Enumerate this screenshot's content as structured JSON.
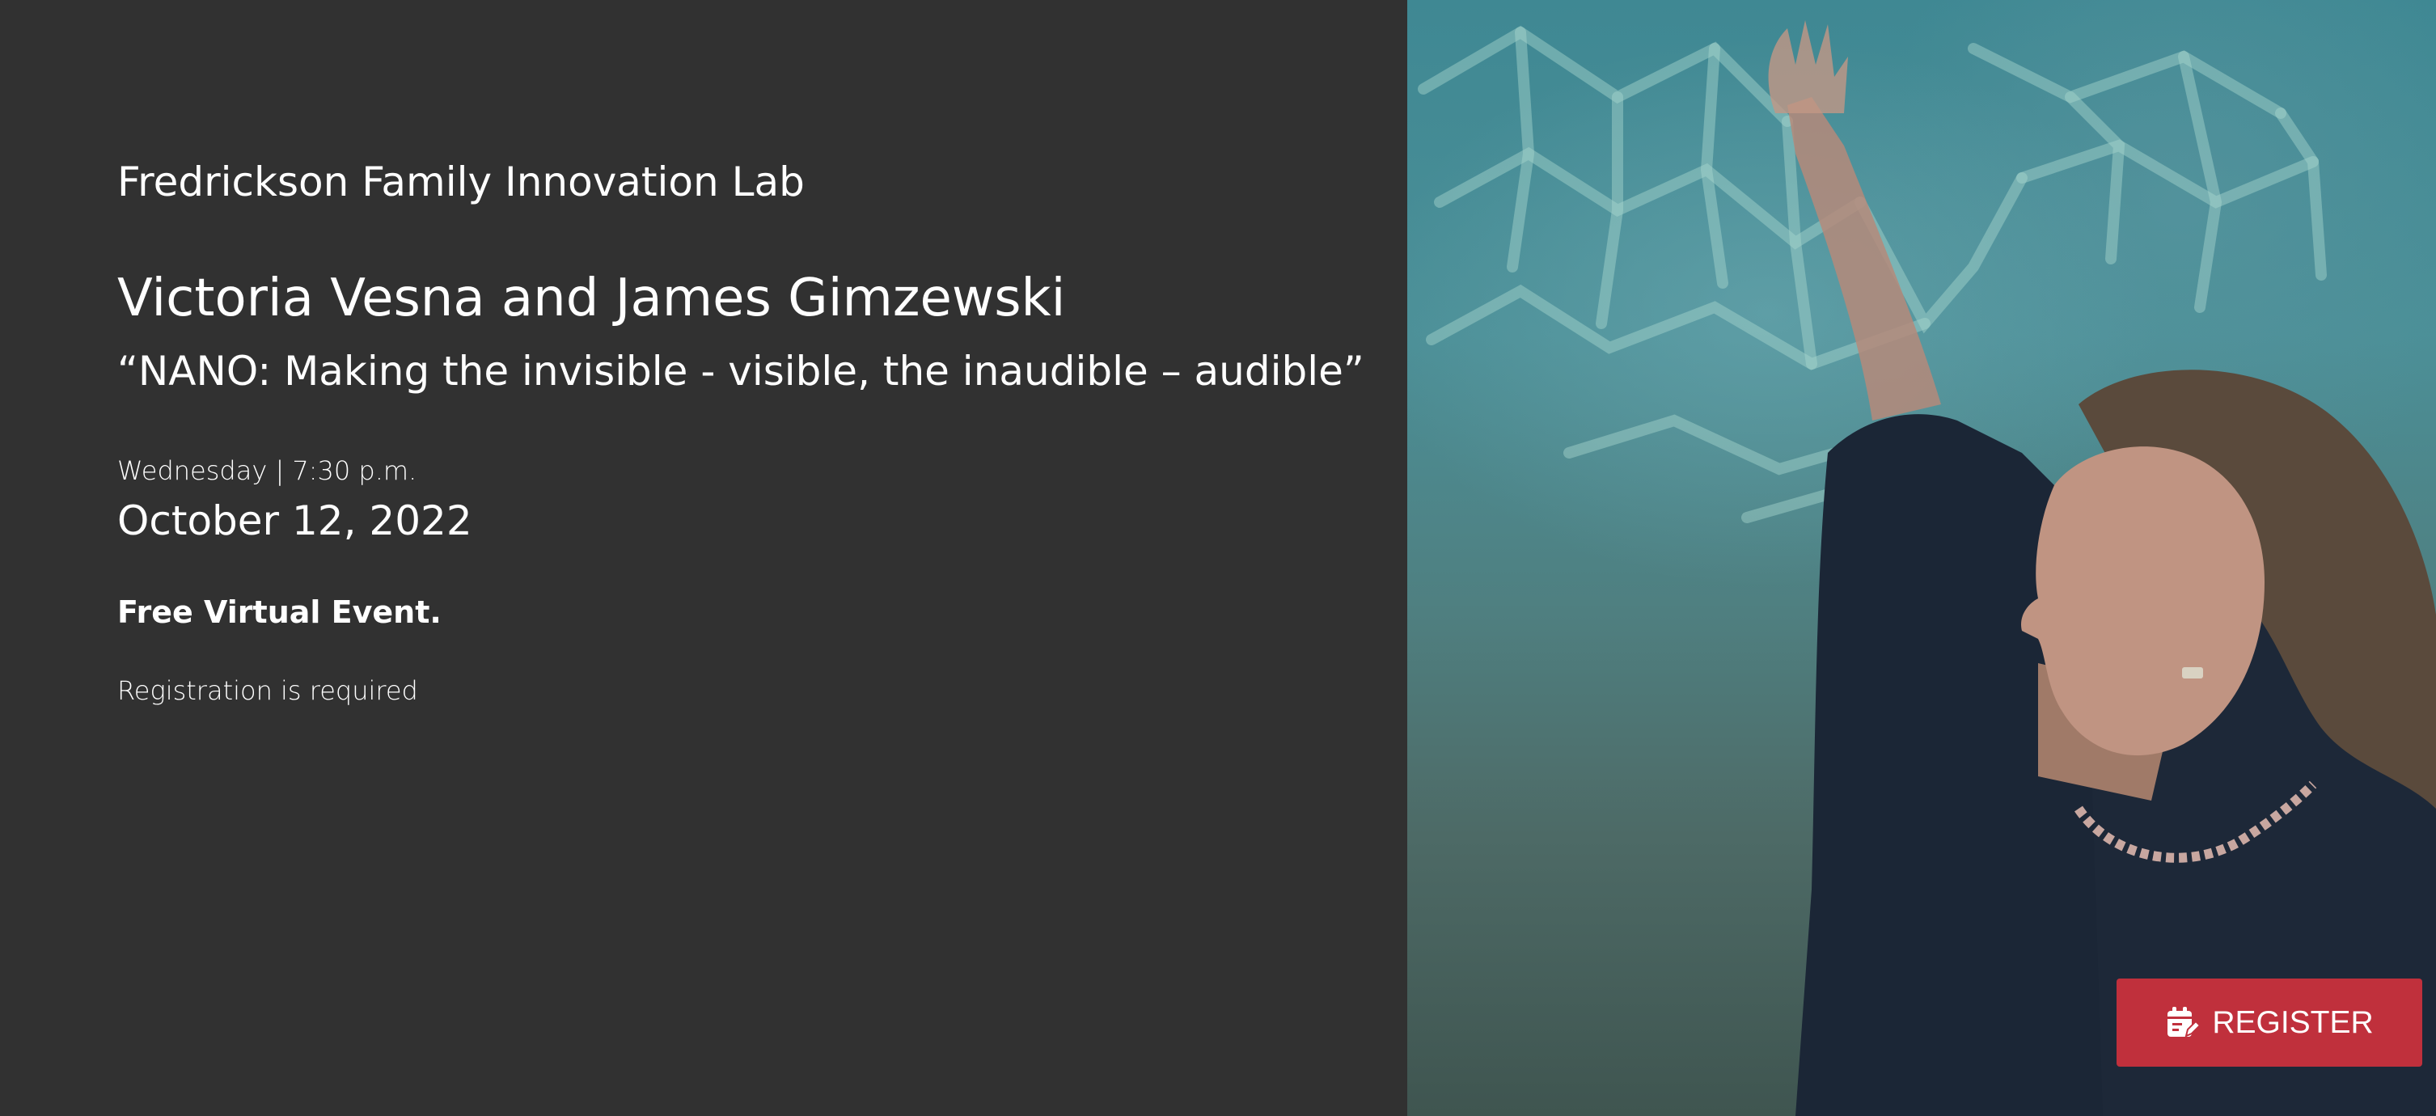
{
  "event": {
    "venue": "Fredrickson Family Innovation Lab",
    "speakers": "Victoria Vesna and James Gimzewski",
    "talk_title": "“NANO: Making the invisible - visible, the inaudible – audible”",
    "weekday_time": "Wednesday | 7:30 p.m.",
    "date": "October 12, 2022",
    "admission": "Free Virtual Event.",
    "registration_note": "Registration is required"
  },
  "register_button": {
    "label": "REGISTER",
    "icon": "calendar-edit-icon",
    "color": "#c0303c"
  },
  "colors": {
    "panel_background": "#313131",
    "text": "#ffffff"
  }
}
